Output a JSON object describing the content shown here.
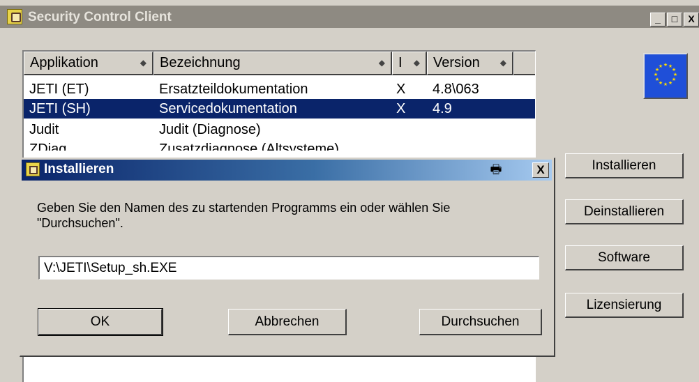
{
  "main_window": {
    "title": "Security Control Client",
    "controls": {
      "minimize": "_",
      "maximize": "□",
      "close": "X"
    }
  },
  "list": {
    "columns": [
      {
        "label": "Applikation",
        "sort": "◆"
      },
      {
        "label": "Bezeichnung",
        "sort": "◆"
      },
      {
        "label": "I",
        "sort": "◆"
      },
      {
        "label": "Version",
        "sort": "◆"
      }
    ],
    "rows": [
      {
        "app": "JETI (ET)",
        "desc": "Ersatzteildokumentation",
        "i": "X",
        "version": "4.8\\063",
        "selected": false
      },
      {
        "app": "JETI (SH)",
        "desc": "Servicedokumentation",
        "i": "X",
        "version": "4.9",
        "selected": true
      },
      {
        "app": "Judit",
        "desc": "Judit (Diagnose)",
        "i": "",
        "version": "",
        "selected": false
      },
      {
        "app": "ZDiag",
        "desc": "Zusatzdiagnose (Altsysteme)",
        "i": "",
        "version": "",
        "selected": false
      }
    ]
  },
  "side_buttons": {
    "install": "Installieren",
    "uninstall": "Deinstallieren",
    "software": "Software",
    "license": "Lizensierung"
  },
  "dialog": {
    "title": "Installieren",
    "message": "Geben Sie den Namen des zu startenden Programms ein oder wählen Sie \"Durchsuchen\".",
    "input_value": "V:\\JETI\\Setup_sh.EXE",
    "close": "X",
    "printer_icon": "🖶",
    "buttons": {
      "ok": "OK",
      "cancel": "Abbrechen",
      "browse": "Durchsuchen"
    }
  },
  "colors": {
    "face": "#d4d0c8",
    "selection": "#0a246a",
    "eu_blue": "#1f4fd8",
    "eu_star": "#ffdd00"
  },
  "icons": [
    "app-icon",
    "printer-icon",
    "close-icon",
    "eu-flag-icon",
    "sort-icon"
  ]
}
